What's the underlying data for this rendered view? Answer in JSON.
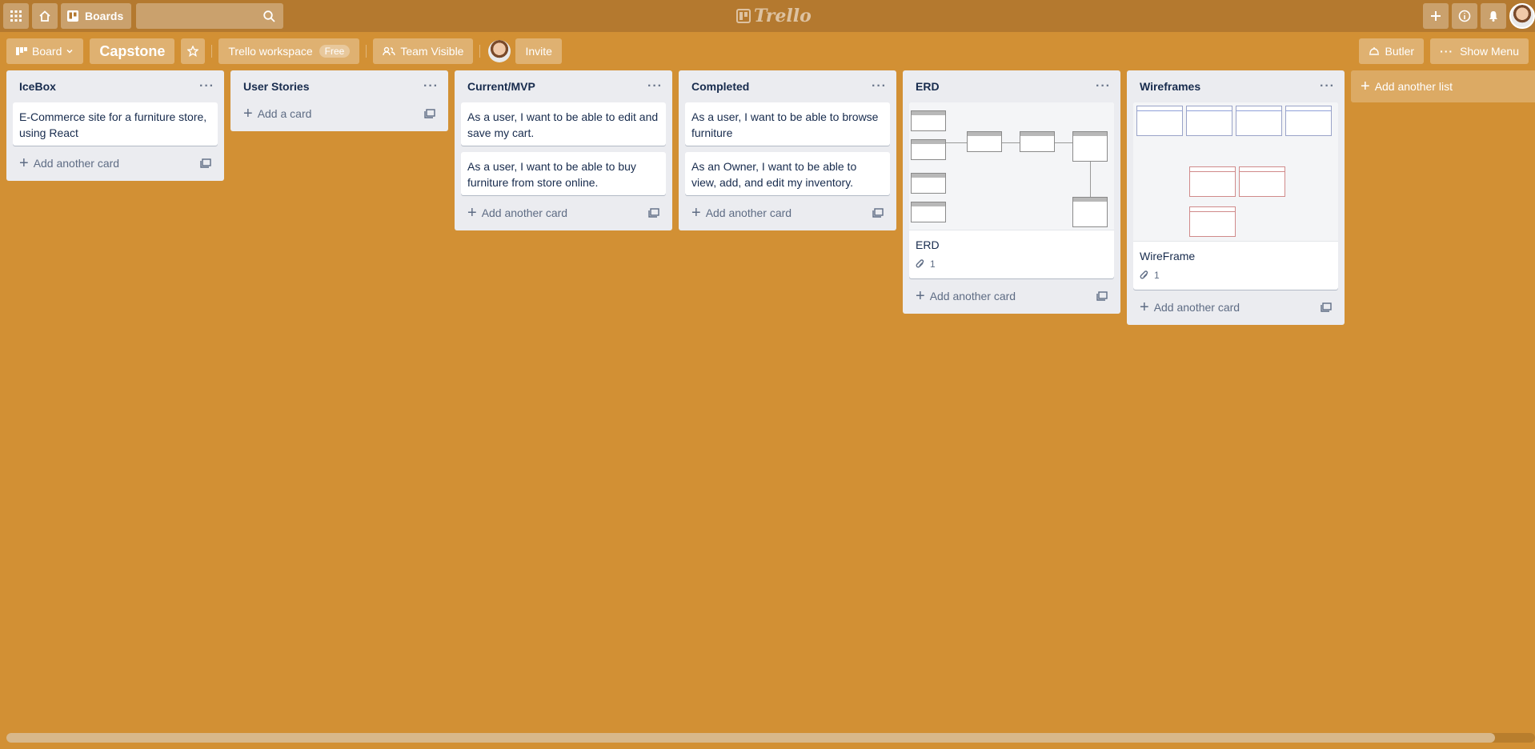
{
  "header": {
    "boards_label": "Boards",
    "logo_text": "Trello"
  },
  "board": {
    "view_label": "Board",
    "title": "Capstone",
    "workspace_label": "Trello workspace",
    "workspace_badge": "Free",
    "visibility_label": "Team Visible",
    "invite_label": "Invite",
    "butler_label": "Butler",
    "show_menu_label": "Show Menu"
  },
  "lists": [
    {
      "title": "IceBox",
      "cards": [
        "E-Commerce site for a furniture store, using React"
      ],
      "add_label": "Add another card"
    },
    {
      "title": "User Stories",
      "cards": [],
      "add_label": "Add a card"
    },
    {
      "title": "Current/MVP",
      "cards": [
        "As a user, I want to be able to edit and save my cart.",
        "As a user, I want to be able to buy furniture from store online."
      ],
      "add_label": "Add another card"
    },
    {
      "title": "Completed",
      "cards": [
        "As a user, I want to be able to browse furniture",
        "As an Owner, I want to be able to view, add, and edit my inventory."
      ],
      "add_label": "Add another card"
    },
    {
      "title": "ERD",
      "image_card": {
        "title": "ERD",
        "attachments": "1"
      },
      "add_label": "Add another card"
    },
    {
      "title": "Wireframes",
      "image_card": {
        "title": "WireFrame",
        "attachments": "1"
      },
      "add_label": "Add another card"
    }
  ],
  "add_list_label": "Add another list",
  "colors": {
    "background": "#d29034",
    "header": "#b4792f",
    "list": "#ebecf0"
  }
}
